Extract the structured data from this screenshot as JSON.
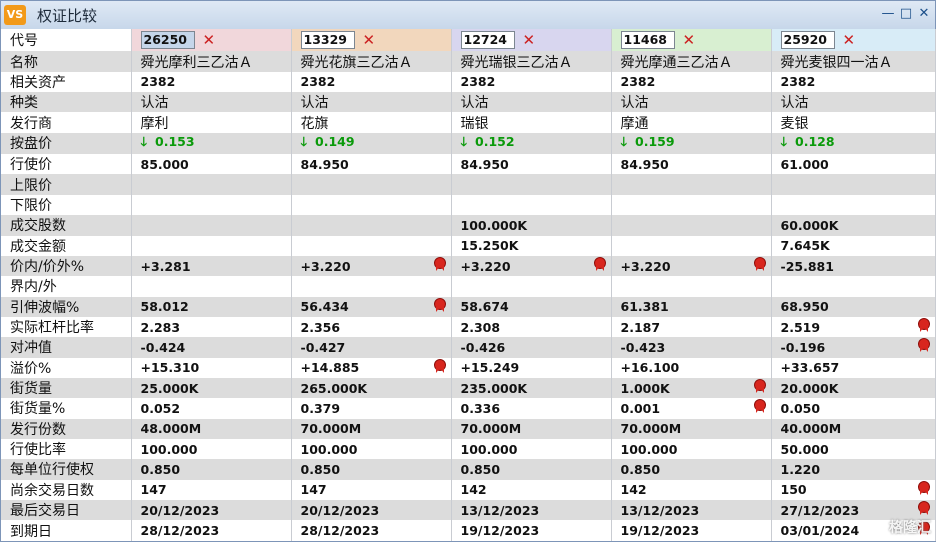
{
  "window": {
    "title": "权证比较",
    "app_icon_text": "VS",
    "controls": [
      "—",
      "□",
      "✕"
    ]
  },
  "columns": [
    {
      "code": "26250",
      "color": "#f1d7db",
      "selected": true
    },
    {
      "code": "13329",
      "color": "#f2d7bd",
      "selected": false
    },
    {
      "code": "12724",
      "color": "#d8d6ef",
      "selected": false
    },
    {
      "code": "11468",
      "color": "#d8efd1",
      "selected": false
    },
    {
      "code": "25920",
      "color": "#d8ecf7",
      "selected": false
    }
  ],
  "close_glyph": "✕",
  "medal_color": "#d8261e",
  "rows": [
    {
      "label": "代号",
      "type": "code"
    },
    {
      "label": "名称",
      "type": "text",
      "values": [
        "舜光摩利三乙沽Ａ",
        "舜光花旗三乙沽Ａ",
        "舜光瑞银三乙沽Ａ",
        "舜光摩通三乙沽Ａ",
        "舜光麦银四一沽Ａ"
      ]
    },
    {
      "label": "相关资产",
      "type": "val",
      "values": [
        "2382",
        "2382",
        "2382",
        "2382",
        "2382"
      ]
    },
    {
      "label": "种类",
      "type": "text",
      "values": [
        "认沽",
        "认沽",
        "认沽",
        "认沽",
        "认沽"
      ]
    },
    {
      "label": "发行商",
      "type": "text",
      "values": [
        "摩利",
        "花旗",
        "瑞银",
        "摩通",
        "麦银"
      ]
    },
    {
      "label": "按盘价",
      "type": "price",
      "values": [
        "0.153",
        "0.149",
        "0.152",
        "0.159",
        "0.128"
      ]
    },
    {
      "label": "行使价",
      "type": "val",
      "values": [
        "85.000",
        "84.950",
        "84.950",
        "84.950",
        "61.000"
      ]
    },
    {
      "label": "上限价",
      "type": "val",
      "values": [
        "",
        "",
        "",
        "",
        ""
      ]
    },
    {
      "label": "下限价",
      "type": "val",
      "values": [
        "",
        "",
        "",
        "",
        ""
      ]
    },
    {
      "label": "成交股数",
      "type": "val",
      "values": [
        "",
        "",
        "100.000K",
        "",
        "60.000K"
      ]
    },
    {
      "label": "成交金额",
      "type": "val",
      "values": [
        "",
        "",
        "15.250K",
        "",
        "7.645K"
      ]
    },
    {
      "label": "价内/价外%",
      "type": "val",
      "values": [
        "+3.281",
        "+3.220",
        "+3.220",
        "+3.220",
        "-25.881"
      ],
      "medals": [
        false,
        true,
        true,
        true,
        false
      ]
    },
    {
      "label": "界内/外",
      "type": "val",
      "values": [
        "",
        "",
        "",
        "",
        ""
      ]
    },
    {
      "label": "引伸波幅%",
      "type": "val",
      "values": [
        "58.012",
        "56.434",
        "58.674",
        "61.381",
        "68.950"
      ],
      "medals": [
        false,
        true,
        false,
        false,
        false
      ]
    },
    {
      "label": "实际杠杆比率",
      "type": "val",
      "values": [
        "2.283",
        "2.356",
        "2.308",
        "2.187",
        "2.519"
      ],
      "medals": [
        false,
        false,
        false,
        false,
        true
      ]
    },
    {
      "label": "对冲值",
      "type": "val",
      "values": [
        "-0.424",
        "-0.427",
        "-0.426",
        "-0.423",
        "-0.196"
      ],
      "medals": [
        false,
        false,
        false,
        false,
        true
      ]
    },
    {
      "label": "溢价%",
      "type": "val",
      "values": [
        "+15.310",
        "+14.885",
        "+15.249",
        "+16.100",
        "+33.657"
      ],
      "medals": [
        false,
        true,
        false,
        false,
        false
      ]
    },
    {
      "label": "街货量",
      "type": "val",
      "values": [
        "25.000K",
        "265.000K",
        "235.000K",
        "1.000K",
        "20.000K"
      ],
      "medals": [
        false,
        false,
        false,
        true,
        false
      ]
    },
    {
      "label": "街货量%",
      "type": "val",
      "values": [
        "0.052",
        "0.379",
        "0.336",
        "0.001",
        "0.050"
      ],
      "medals": [
        false,
        false,
        false,
        true,
        false
      ]
    },
    {
      "label": "发行份数",
      "type": "val",
      "values": [
        "48.000M",
        "70.000M",
        "70.000M",
        "70.000M",
        "40.000M"
      ]
    },
    {
      "label": "行使比率",
      "type": "val",
      "values": [
        "100.000",
        "100.000",
        "100.000",
        "100.000",
        "50.000"
      ]
    },
    {
      "label": "每单位行使权",
      "type": "val",
      "values": [
        "0.850",
        "0.850",
        "0.850",
        "0.850",
        "1.220"
      ]
    },
    {
      "label": "尚余交易日数",
      "type": "val",
      "values": [
        "147",
        "147",
        "142",
        "142",
        "150"
      ],
      "medals": [
        false,
        false,
        false,
        false,
        true
      ]
    },
    {
      "label": "最后交易日",
      "type": "val",
      "values": [
        "20/12/2023",
        "20/12/2023",
        "13/12/2023",
        "13/12/2023",
        "27/12/2023"
      ],
      "medals": [
        false,
        false,
        false,
        false,
        true
      ]
    },
    {
      "label": "到期日",
      "type": "val",
      "values": [
        "28/12/2023",
        "28/12/2023",
        "19/12/2023",
        "19/12/2023",
        "03/01/2024"
      ],
      "medals": [
        false,
        false,
        false,
        false,
        true
      ]
    }
  ],
  "watermark": "格隆汇"
}
